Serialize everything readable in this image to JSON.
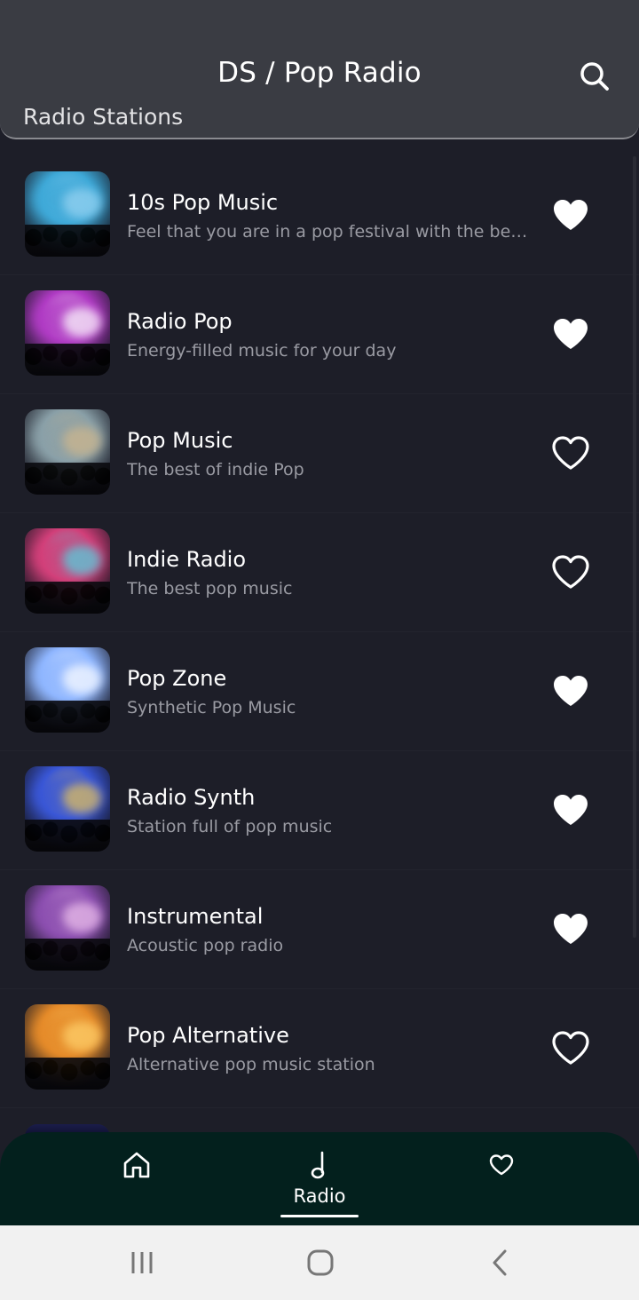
{
  "header": {
    "title": "DS / Pop Radio",
    "subtitle": "Radio Stations",
    "search_icon": "search-icon"
  },
  "stations": [
    {
      "title": "10s Pop Music",
      "desc": "Feel that you are in a pop festival with the best pop music",
      "favorite": true,
      "colors": [
        "#3fa9d8",
        "#9ad4f2"
      ]
    },
    {
      "title": "Radio Pop",
      "desc": "Energy-filled music for your day",
      "favorite": true,
      "colors": [
        "#b03cc4",
        "#ffffff"
      ]
    },
    {
      "title": "Pop Music",
      "desc": "The best of indie Pop",
      "favorite": false,
      "colors": [
        "#8aa0a8",
        "#d0b78c"
      ]
    },
    {
      "title": "Indie Radio",
      "desc": "The best pop music",
      "favorite": false,
      "colors": [
        "#d2407a",
        "#4fd6e2"
      ]
    },
    {
      "title": "Pop Zone",
      "desc": "Synthetic Pop Music",
      "favorite": true,
      "colors": [
        "#8fb6ff",
        "#ffffff"
      ]
    },
    {
      "title": "Radio Synth",
      "desc": "Station full of pop music",
      "favorite": true,
      "colors": [
        "#3a57d6",
        "#e6c35a"
      ]
    },
    {
      "title": "Instrumental",
      "desc": "Acoustic pop radio",
      "favorite": true,
      "colors": [
        "#8c4fb0",
        "#f0c4ee"
      ]
    },
    {
      "title": "Pop Alternative",
      "desc": "Alternative pop music station",
      "favorite": false,
      "colors": [
        "#e58b2a",
        "#ffd36e"
      ]
    }
  ],
  "bottom_nav": {
    "items": [
      {
        "name": "home",
        "icon": "home-icon",
        "label": ""
      },
      {
        "name": "radio",
        "icon": "music-note-icon",
        "label": "Radio",
        "active": true
      },
      {
        "name": "favorites",
        "icon": "heart-icon",
        "label": ""
      }
    ]
  },
  "system_nav": {
    "recents_icon": "recents-icon",
    "home_icon": "home-circle-icon",
    "back_icon": "back-icon"
  },
  "colors": {
    "background": "#1d1e28",
    "header": "#3a3c43",
    "bottom_nav": "#03201d",
    "text_primary": "#ffffff",
    "text_secondary": "#9a9ba3"
  }
}
